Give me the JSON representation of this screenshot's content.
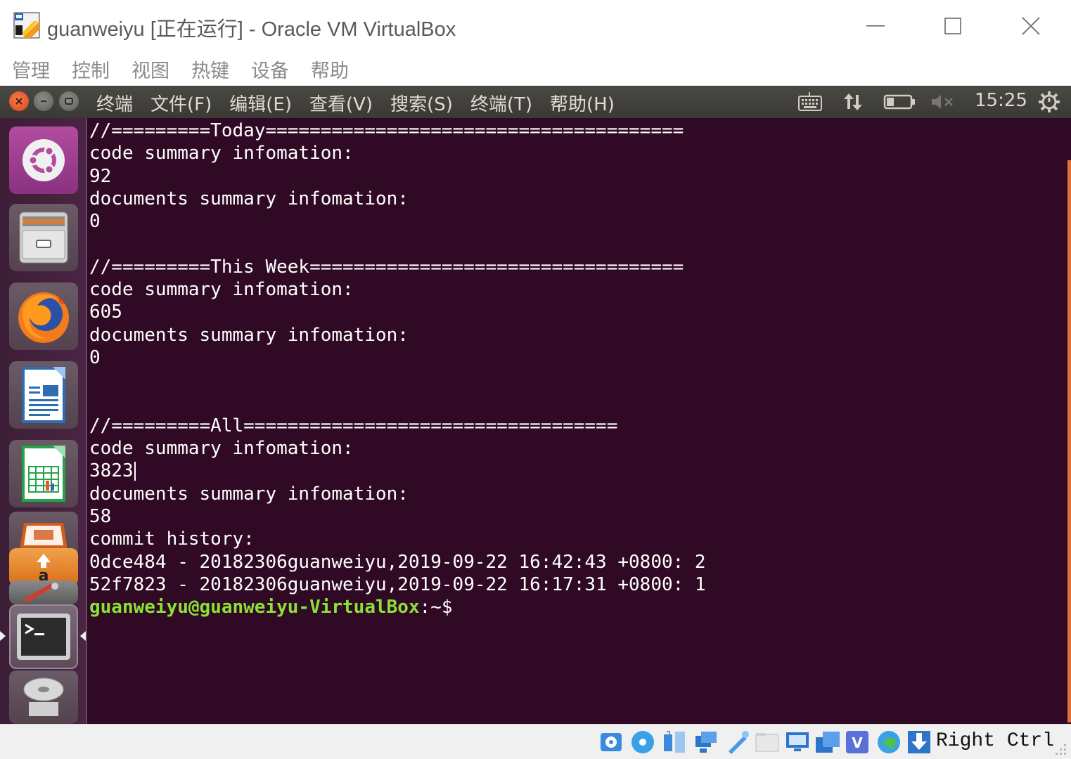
{
  "window": {
    "title": "guanweiyu [正在运行] - Oracle VM VirtualBox"
  },
  "vbox_menu": [
    "管理",
    "控制",
    "视图",
    "热键",
    "设备",
    "帮助"
  ],
  "ubuntu_panel": {
    "menu": [
      "终端",
      "文件(F)",
      "编辑(E)",
      "查看(V)",
      "搜索(S)",
      "终端(T)",
      "帮助(H)"
    ],
    "clock": "15:25"
  },
  "launcher": {
    "items": [
      "ubuntu-dash-icon",
      "files-icon",
      "firefox-icon",
      "writer-icon",
      "calc-icon",
      "impress-icon",
      "amazon-icon",
      "system-settings-icon",
      "terminal-icon",
      "dvd-icon"
    ]
  },
  "terminal": {
    "lines": [
      "//=========Today======================================",
      "code summary infomation:",
      "92",
      "documents summary infomation:",
      "0",
      "",
      "//=========This Week==================================",
      "code summary infomation:",
      "605",
      "documents summary infomation:",
      "0",
      "",
      "",
      "//=========All==================================",
      "code summary infomation:",
      "3823",
      "documents summary infomation:",
      "58",
      "commit history:",
      "0dce484 - 20182306guanweiyu,2019-09-22 16:42:43 +0800: 2",
      "52f7823 - 20182306guanweiyu,2019-09-22 16:17:31 +0800: 1"
    ],
    "prompt_user": "guanweiyu@guanweiyu-VirtualBox",
    "prompt_path": ":~$"
  },
  "statusbar": {
    "host_key": "Right Ctrl"
  },
  "colors": {
    "terminal_bg": "#300a24",
    "prompt_green": "#8ae234",
    "panel_bg": "#3c3b37"
  }
}
